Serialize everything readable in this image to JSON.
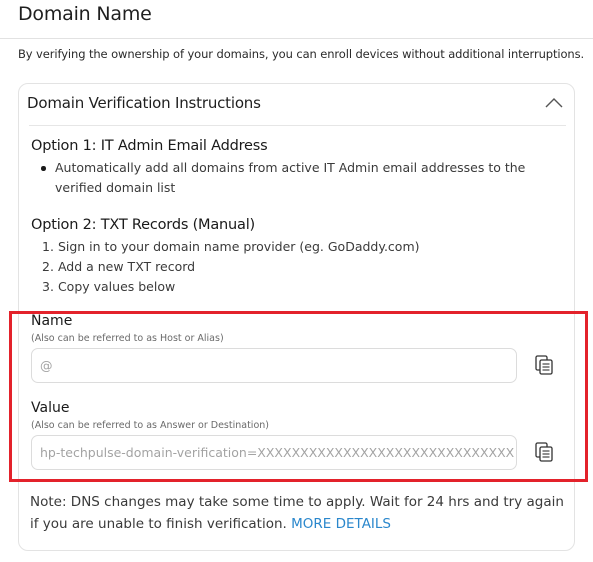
{
  "page": {
    "title": "Domain Name",
    "intro": "By verifying the ownership of your domains, you can enroll devices without additional interruptions."
  },
  "card": {
    "title": "Domain Verification Instructions",
    "collapse_icon": "chevron-up-icon",
    "option1": {
      "title": "Option 1: IT Admin Email Address",
      "bullets": [
        "Automatically add all domains from active IT Admin email addresses to the verified domain list"
      ]
    },
    "option2": {
      "title": "Option 2: TXT Records (Manual)",
      "steps": [
        {
          "num": "1.",
          "text": "Sign in to your domain name provider (eg. GoDaddy.com)"
        },
        {
          "num": "2.",
          "text": "Add a new TXT record"
        },
        {
          "num": "3.",
          "text": "Copy values below"
        }
      ]
    },
    "name_field": {
      "label": "Name",
      "sublabel": "(Also can be referred to as Host or Alias)",
      "value": "@",
      "copy_icon": "copy-icon"
    },
    "value_field": {
      "label": "Value",
      "sublabel": "(Also can be referred to as Answer or Destination)",
      "value": "hp-techpulse-domain-verification=XXXXXXXXXXXXXXXXXXXXXXXXXXXXXX",
      "copy_icon": "copy-icon"
    },
    "note": {
      "text": "Note: DNS changes may take some time to apply. Wait for 24 hrs and try again if you are unable to finish verification. ",
      "link": "MORE DETAILS"
    }
  },
  "colors": {
    "highlight_border": "#e3222b",
    "link": "#2a87cc"
  }
}
